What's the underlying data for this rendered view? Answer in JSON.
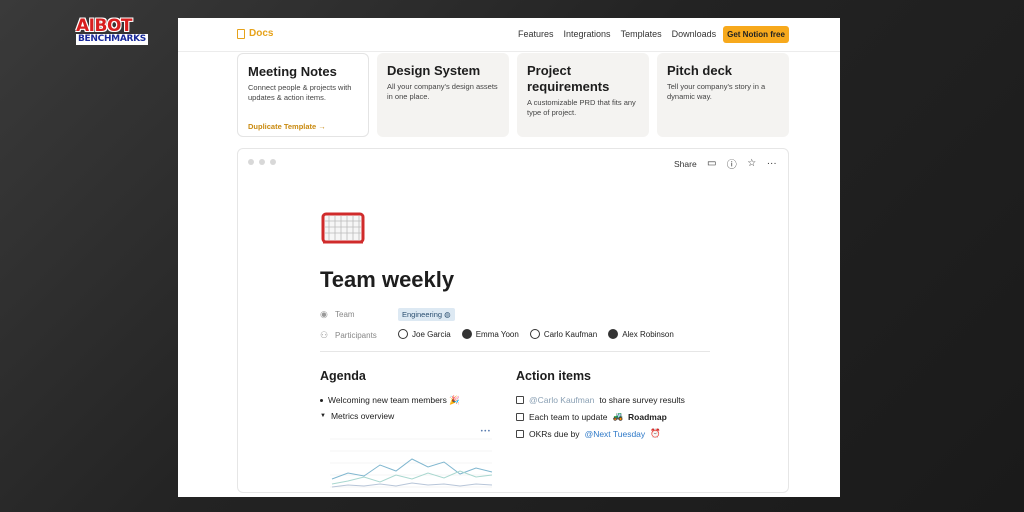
{
  "watermark": {
    "line1": "AIBOT",
    "line2": "BENCHMARKS"
  },
  "nav": {
    "brand": "Docs",
    "links": [
      "Features",
      "Integrations",
      "Templates",
      "Downloads"
    ],
    "cta": "Get Notion free"
  },
  "templates": [
    {
      "title": "Meeting Notes",
      "desc": "Connect people & projects with updates & action items.",
      "action": "Duplicate Template →"
    },
    {
      "title": "Design System",
      "desc": "All your company's design assets in one place."
    },
    {
      "title": "Project requirements",
      "desc": "A customizable PRD that fits any type of project."
    },
    {
      "title": "Pitch deck",
      "desc": "Tell your company's story in a dynamic way."
    }
  ],
  "doc": {
    "toolbar": {
      "share": "Share",
      "icons": [
        "comment-icon",
        "info-icon",
        "star-icon",
        "more-icon"
      ]
    },
    "icon": "hockey-goal-icon",
    "title": "Team weekly",
    "props": {
      "team_label": "Team",
      "team_value": "Engineering",
      "participants_label": "Participants",
      "participants": [
        "Joe Garcia",
        "Emma Yoon",
        "Carlo Kaufman",
        "Alex Robinson"
      ]
    },
    "agenda": {
      "heading": "Agenda",
      "items": [
        "Welcoming new team members 🎉",
        "Metrics overview"
      ]
    },
    "actions": {
      "heading": "Action items",
      "items": [
        {
          "mention": "@Carlo Kaufman",
          "text": "to share survey results"
        },
        {
          "text": "Each team to update",
          "link": "Roadmap"
        },
        {
          "text": "OKRs due by",
          "mention": "@Next Tuesday"
        }
      ]
    }
  },
  "colors": {
    "accent": "#f7a91c",
    "brand": "#e6a21a",
    "mention": "#2e79c8"
  }
}
